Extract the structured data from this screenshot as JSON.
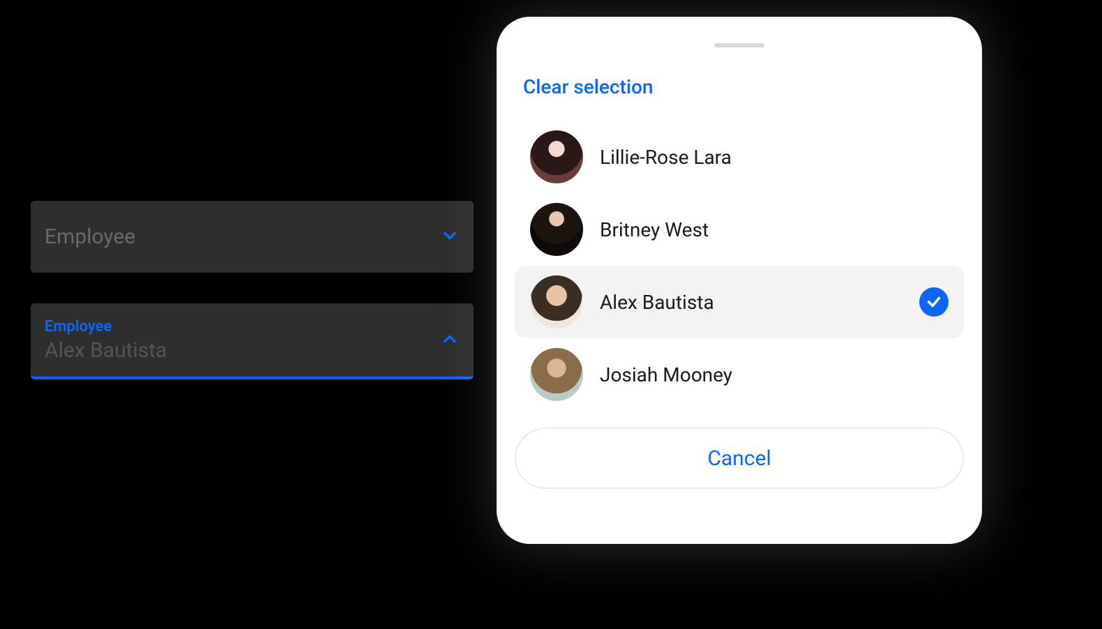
{
  "colors": {
    "accent": "#0a66ff",
    "dim_bg": "#2e2e2e"
  },
  "left": {
    "collapsed": {
      "placeholder": "Employee"
    },
    "expanded": {
      "float_label": "Employee",
      "value": "Alex Bautista"
    }
  },
  "sheet": {
    "clear_label": "Clear selection",
    "cancel_label": "Cancel",
    "selected_index": 2,
    "options": [
      {
        "name": "Lillie-Rose Lara",
        "avatar_icon": "avatar-lillie"
      },
      {
        "name": "Britney West",
        "avatar_icon": "avatar-britney"
      },
      {
        "name": "Alex Bautista",
        "avatar_icon": "avatar-alex"
      },
      {
        "name": "Josiah Mooney",
        "avatar_icon": "avatar-josiah"
      }
    ]
  }
}
